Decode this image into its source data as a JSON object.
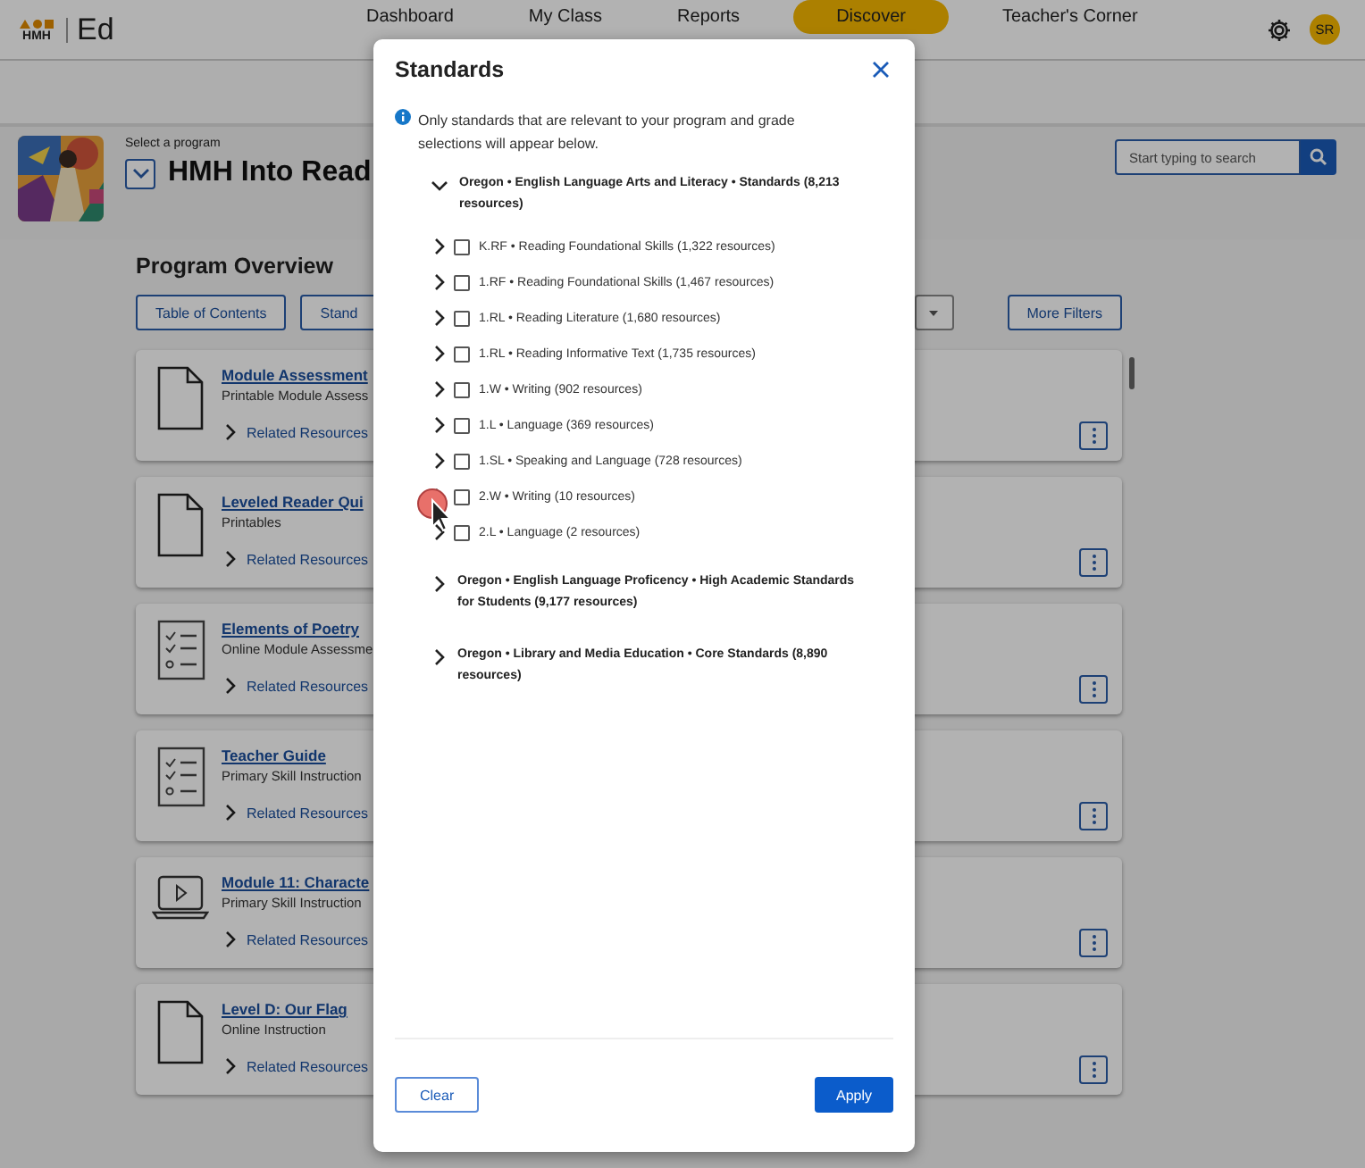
{
  "header": {
    "logo_text": "HMH",
    "app_name": "Ed",
    "nav": [
      {
        "label": "Dashboard",
        "selected": false
      },
      {
        "label": "My Class",
        "selected": false
      },
      {
        "label": "Reports",
        "selected": false
      },
      {
        "label": "Discover",
        "selected": true
      },
      {
        "label": "Teacher's Corner",
        "selected": false
      }
    ],
    "avatar": "SR"
  },
  "program": {
    "select_label": "Select a program",
    "name": "HMH Into Read",
    "search": {
      "placeholder": "Start typing to search"
    }
  },
  "overview": {
    "title": "Program Overview",
    "filters": [
      "Table of Contents",
      "Stand"
    ],
    "more_filters": "More Filters",
    "resources": [
      {
        "kind": "pdf",
        "title": "Module Assessment",
        "subtitle": "Printable Module Assess",
        "related": "Related Resources"
      },
      {
        "kind": "pdf",
        "title": "Leveled Reader Qui",
        "subtitle": "Printables",
        "related": "Related Resources"
      },
      {
        "kind": "checklist",
        "title": "Elements of Poetry",
        "subtitle": "Online Module Assessme",
        "related": "Related Resources"
      },
      {
        "kind": "checklist",
        "title": "Teacher Guide",
        "subtitle": "Primary Skill Instruction",
        "related": "Related Resources"
      },
      {
        "kind": "video",
        "title": "Module 11: Characte",
        "subtitle": "Primary Skill Instruction",
        "related": "Related Resources"
      },
      {
        "kind": "pdf",
        "title": "Level D: Our Flag",
        "subtitle": "Online Instruction",
        "related": "Related Resources"
      }
    ]
  },
  "modal": {
    "title": "Standards",
    "info": "Only standards that are relevant to your program and grade selections will appear below.",
    "tree": [
      {
        "label": "Oregon • English Language Arts and Literacy • Standards (8,213 resources)",
        "expanded": true,
        "children": [
          {
            "label": "K.RF • Reading Foundational Skills (1,322 resources)",
            "expanded": false,
            "checked": false
          },
          {
            "label": "1.RF • Reading Foundational Skills (1,467 resources)",
            "expanded": false,
            "checked": false
          },
          {
            "label": "1.RL • Reading Literature (1,680 resources)",
            "expanded": false,
            "checked": false
          },
          {
            "label": "1.RL • Reading Informative Text (1,735 resources)",
            "expanded": false,
            "checked": false
          },
          {
            "label": "1.W • Writing (902 resources)",
            "expanded": false,
            "checked": false
          },
          {
            "label": "1.L • Language (369 resources)",
            "expanded": false,
            "checked": false
          },
          {
            "label": "1.SL • Speaking and Language (728 resources)",
            "expanded": false,
            "checked": false
          },
          {
            "label": "2.W • Writing (10 resources)",
            "expanded": false,
            "checked": false
          },
          {
            "label": "2.L • Language (2 resources)",
            "expanded": false,
            "checked": false
          }
        ]
      },
      {
        "label": "Oregon • English Language Proficency • High Academic Standards for Students (9,177 resources)",
        "expanded": false
      },
      {
        "label": "Oregon • Library and Media Education • Core Standards (8,890 resources)",
        "expanded": false
      }
    ],
    "clear": "Clear",
    "apply": "Apply"
  }
}
